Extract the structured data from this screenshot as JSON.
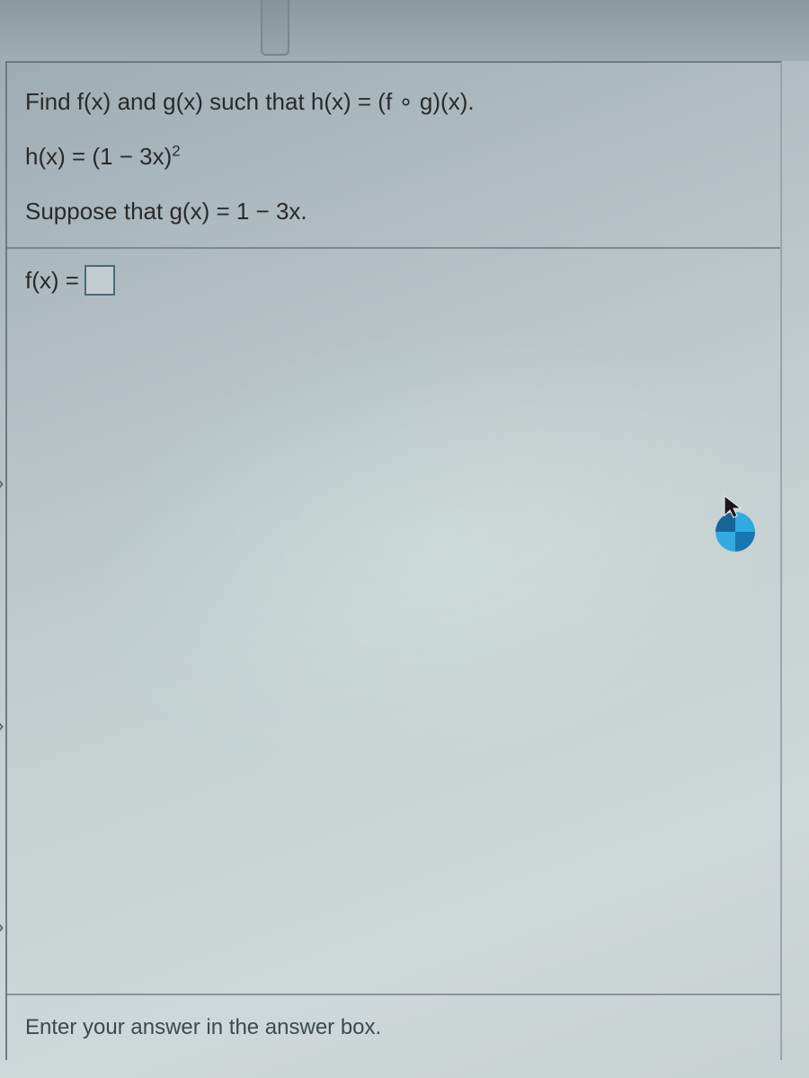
{
  "question": {
    "line1_html": "Find f(x) and g(x) such that h(x) = (f ∘ g)(x).",
    "line2_html": "h(x) = (1 − 3x)<sup>2</sup>",
    "line3_html": "Suppose that g(x) = 1 − 3x."
  },
  "answer": {
    "prompt": "f(x) =",
    "value": ""
  },
  "footer": {
    "hint": "Enter your answer in the answer box."
  },
  "nav": {
    "chevron": "›"
  }
}
